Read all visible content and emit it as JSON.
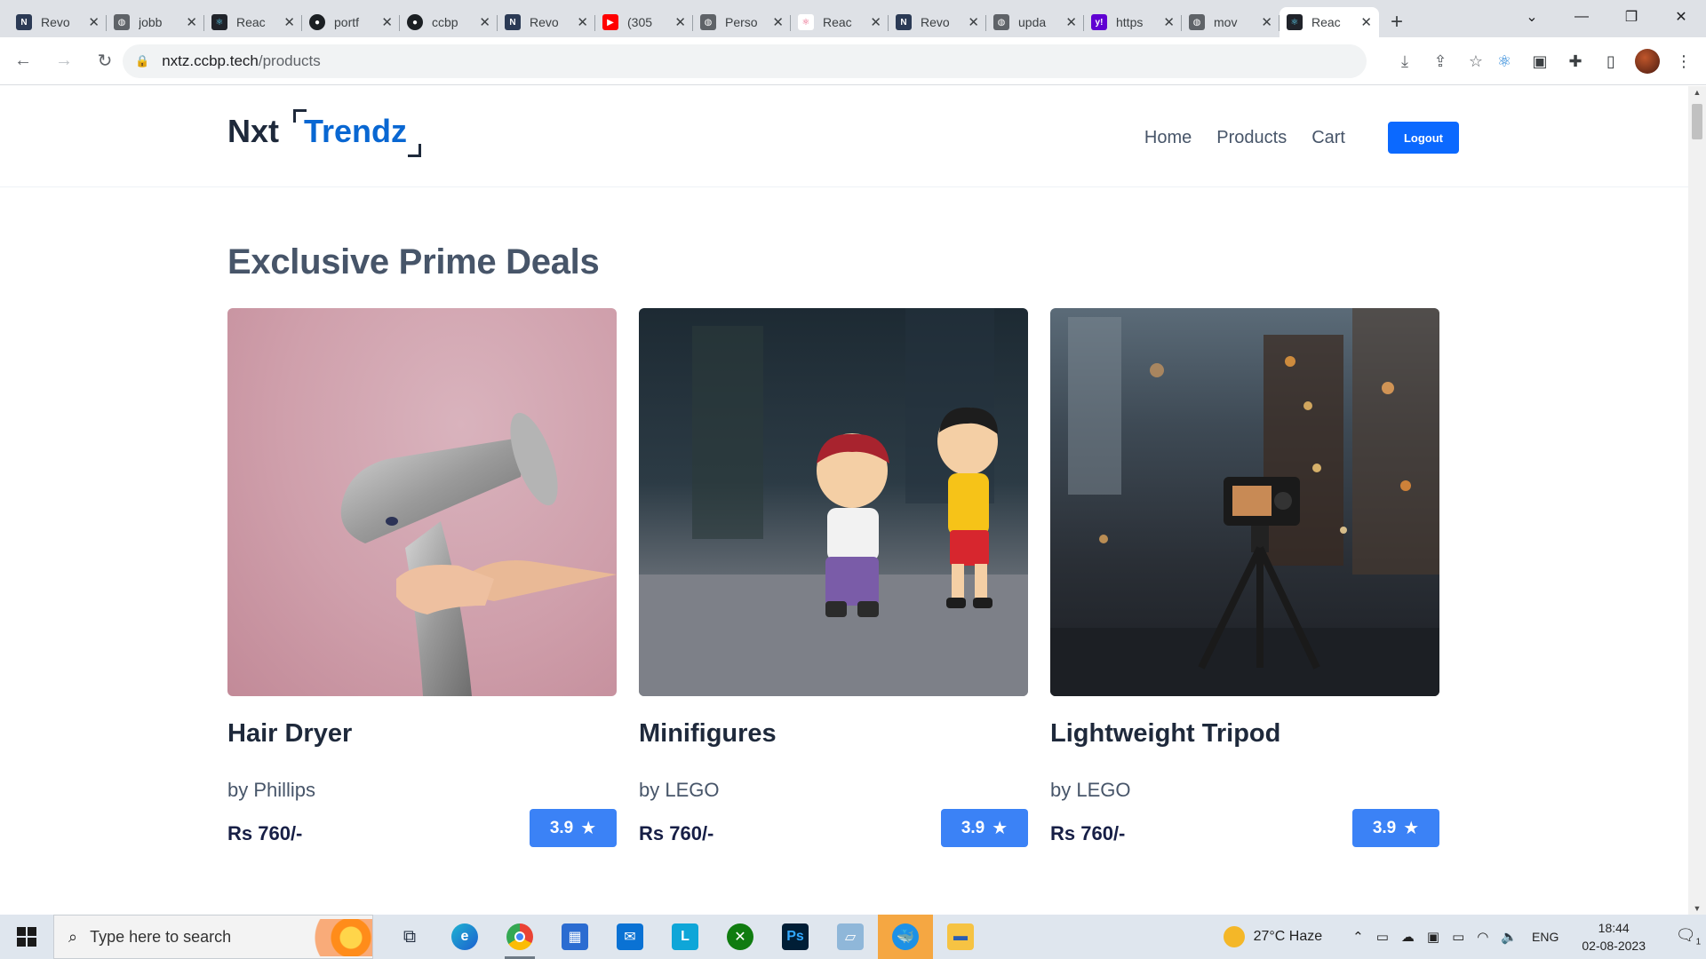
{
  "browser": {
    "tabs": [
      {
        "label": "Revo",
        "favicon": "nxt-wave-icon",
        "color": "#2b3a55"
      },
      {
        "label": "jobb",
        "favicon": "globe-icon",
        "color": "#5f6368"
      },
      {
        "label": "Reac",
        "favicon": "react-icon",
        "color": "#20232a"
      },
      {
        "label": "portf",
        "favicon": "github-icon",
        "color": "#1b1f23"
      },
      {
        "label": "ccbp",
        "favicon": "github-icon",
        "color": "#1b1f23"
      },
      {
        "label": "Revo",
        "favicon": "nxt-wave-icon",
        "color": "#2b3a55"
      },
      {
        "label": "(305",
        "favicon": "youtube-icon",
        "color": "#ff0000"
      },
      {
        "label": "Perso",
        "favicon": "globe-icon",
        "color": "#5f6368"
      },
      {
        "label": "Reac",
        "favicon": "react-pink-icon",
        "color": "#e7537a"
      },
      {
        "label": "Revo",
        "favicon": "nxt-wave-icon",
        "color": "#2b3a55"
      },
      {
        "label": "upda",
        "favicon": "globe-icon",
        "color": "#5f6368"
      },
      {
        "label": "https",
        "favicon": "yahoo-icon",
        "color": "#6001d2"
      },
      {
        "label": "mov",
        "favicon": "globe-icon",
        "color": "#5f6368"
      },
      {
        "label": "Reac",
        "favicon": "react-icon",
        "color": "#20232a",
        "active": true
      }
    ],
    "url_host": "nxtz.ccbp.tech",
    "url_path": "/products"
  },
  "header": {
    "logo_text": "Nxt",
    "logo_accent": "Trendz",
    "nav": {
      "home": "Home",
      "products": "Products",
      "cart": "Cart"
    },
    "logout_label": "Logout"
  },
  "main": {
    "section_title": "Exclusive Prime Deals",
    "products": [
      {
        "title": "Hair Dryer",
        "brand": "by Phillips",
        "price": "Rs 760/-",
        "rating": "3.9"
      },
      {
        "title": "Minifigures",
        "brand": "by LEGO",
        "price": "Rs 760/-",
        "rating": "3.9"
      },
      {
        "title": "Lightweight Tripod",
        "brand": "by LEGO",
        "price": "Rs 760/-",
        "rating": "3.9"
      }
    ]
  },
  "taskbar": {
    "search_placeholder": "Type here to search",
    "weather": "27°C  Haze",
    "language": "ENG",
    "time": "18:44",
    "date": "02-08-2023",
    "notification_count": "1"
  },
  "colors": {
    "brand_blue": "#0967d2",
    "logout_button": "#0b69ff",
    "rating_badge": "#3b82f6",
    "title_text": "#1e293b"
  }
}
